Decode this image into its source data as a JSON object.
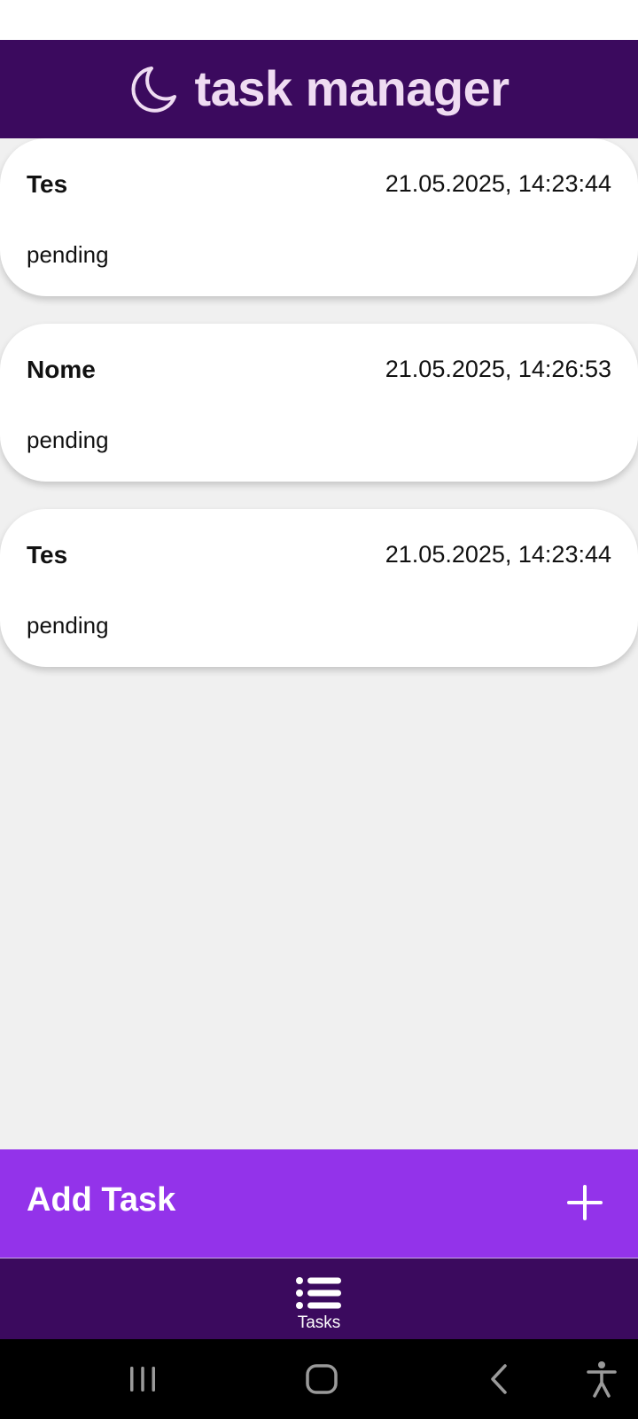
{
  "header": {
    "title": "task manager",
    "icon": "moon-icon",
    "background": "#3b0a5e",
    "title_color": "#efdcf2"
  },
  "tasks": [
    {
      "name": "Tes",
      "date": "21.05.2025, 14:23:44",
      "status": "pending"
    },
    {
      "name": "Nome",
      "date": "21.05.2025, 14:26:53",
      "status": "pending"
    },
    {
      "name": "Tes",
      "date": "21.05.2025, 14:23:44",
      "status": "pending"
    }
  ],
  "add_task": {
    "label": "Add Task",
    "icon": "plus-icon",
    "background": "#9333ea"
  },
  "bottom_nav": {
    "items": [
      {
        "label": "Tasks",
        "icon": "list-icon",
        "active": true
      }
    ]
  },
  "system_nav": {
    "buttons": [
      "recent-apps-icon",
      "home-icon",
      "back-icon",
      "accessibility-icon"
    ]
  }
}
